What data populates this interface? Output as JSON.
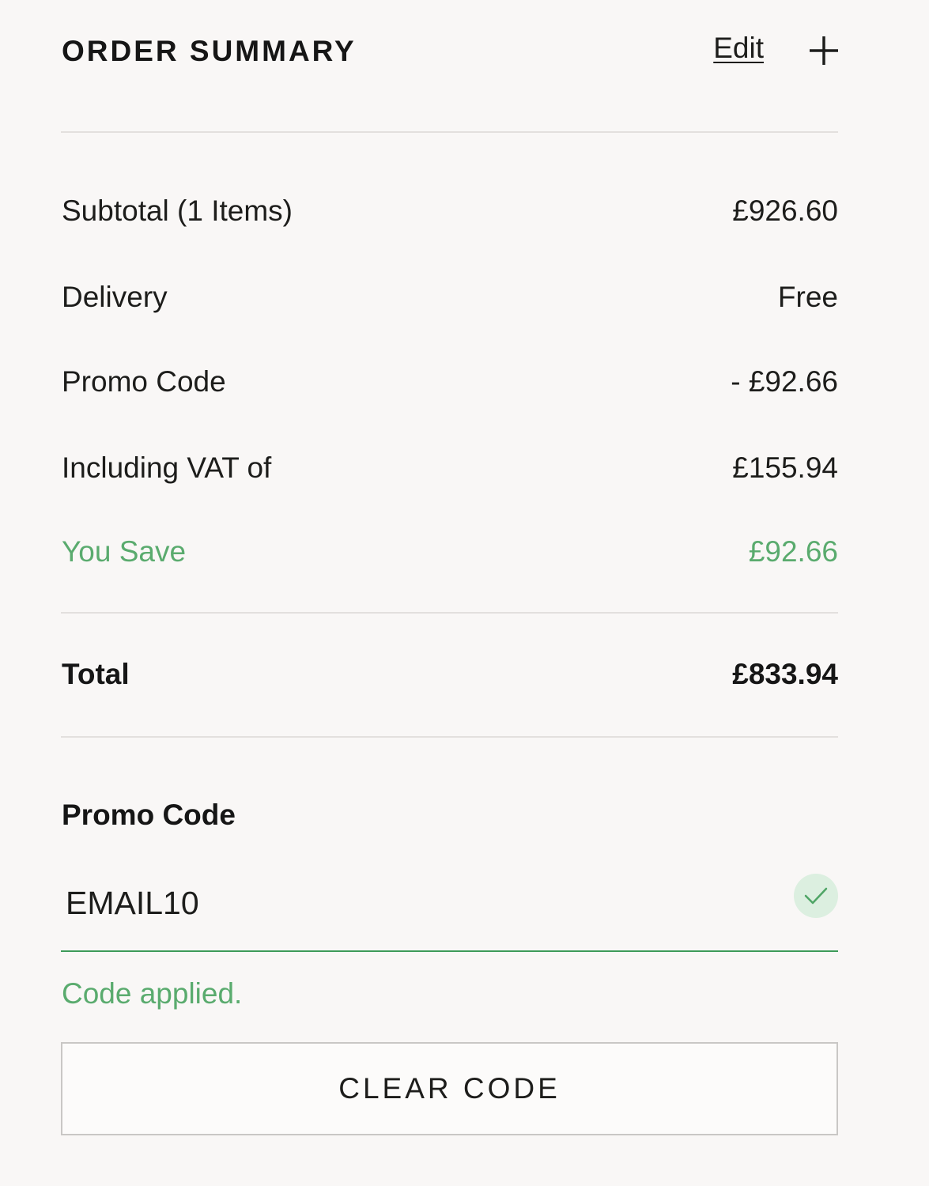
{
  "header": {
    "title": "ORDER SUMMARY",
    "edit_label": "Edit",
    "expand_icon": "plus-icon"
  },
  "summary": {
    "subtotal_label": "Subtotal (1 Items)",
    "subtotal_value": "£926.60",
    "delivery_label": "Delivery",
    "delivery_value": "Free",
    "promo_label": "Promo Code",
    "promo_value": "- £92.66",
    "vat_label": "Including VAT of",
    "vat_value": "£155.94",
    "save_label": "You Save",
    "save_value": "£92.66",
    "total_label": "Total",
    "total_value": "£833.94"
  },
  "promo": {
    "heading": "Promo Code",
    "input_value": "EMAIL10",
    "status_icon": "check-icon",
    "applied_message": "Code applied.",
    "clear_button_label": "CLEAR CODE"
  },
  "colors": {
    "background": "#f9f7f6",
    "text": "#1d1d1b",
    "success_green": "#5aab6e",
    "input_underline": "#3d9b59",
    "check_bg": "#dcefe0",
    "divider": "#e3e0de",
    "button_border": "#c9c7c5"
  }
}
